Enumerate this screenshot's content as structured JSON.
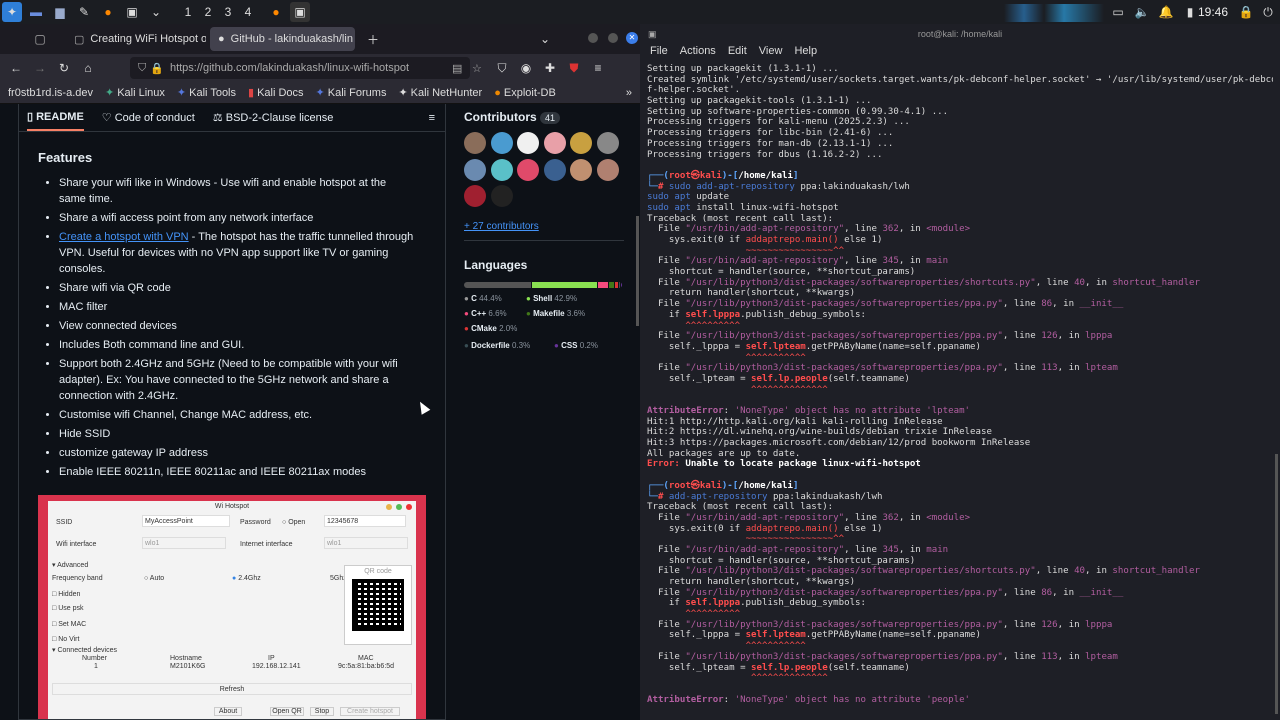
{
  "panel": {
    "workspaces": [
      "1",
      "2",
      "3",
      "4"
    ],
    "clock": "19:46"
  },
  "browser": {
    "tabs": [
      {
        "label": "Creating WiFi Hotspot on"
      },
      {
        "label": "GitHub - lakinduakash/lin"
      }
    ],
    "url": "https://github.com/lakinduakash/linux-wifi-hotspot",
    "bookmarks": [
      "fr0stb1rd.is-a.dev",
      "Kali Linux",
      "Kali Tools",
      "Kali Docs",
      "Kali Forums",
      "Kali NetHunter",
      "Exploit-DB"
    ],
    "readme_tabs": [
      "README",
      "Code of conduct",
      "BSD-2-Clause license"
    ],
    "features_title": "Features",
    "features": [
      "Share your wifi like in Windows - Use wifi and enable hotspot at the same time.",
      "Share a wifi access point from any network interface",
      {
        "link": "Create a hotspot with VPN",
        "rest": " - The hotspot has the traffic tunnelled through VPN. Useful for devices with no VPN app support like TV or gaming consoles."
      },
      "Share wifi via QR code",
      "MAC filter",
      "View connected devices",
      "Includes Both command line and GUI.",
      "Support both 2.4GHz and 5GHz (Need to be compatible with your wifi adapter). Ex: You have connected to the 5GHz network and share a connection with 2.4GHz.",
      "Customise wifi Channel, Change MAC address, etc.",
      "Hide SSID",
      "customize gateway IP address",
      "Enable IEEE 80211n, IEEE 80211ac and IEEE 80211ax modes"
    ],
    "hotspot_app": {
      "title": "Wi Hotspot",
      "ssid_label": "SSID",
      "ssid": "MyAccessPoint",
      "password_label": "Password",
      "open_label": "Open",
      "password": "12345678",
      "wifi_iface_label": "Wifi interface",
      "wifi_iface": "wlo1",
      "inet_iface_label": "Internet interface",
      "inet_iface": "wlo1",
      "advanced": "Advanced",
      "freq_label": "Frequency band",
      "auto": "Auto",
      "ghz24": "2.4Ghz",
      "ghz5": "5Ghz",
      "hidden": "Hidden",
      "use_psk": "Use psk",
      "set_mac": "Set MAC",
      "no_virt": "No Virt",
      "qr_label": "QR code",
      "connected": "Connected devices",
      "cols": [
        "Number",
        "Hostname",
        "IP",
        "MAC"
      ],
      "row": [
        "1",
        "M2101K6G",
        "192.168.12.141",
        "9c:5a:81:ba:b6:5d"
      ],
      "refresh": "Refresh",
      "buttons": [
        "About",
        "Open QR",
        "Stop",
        "Create hotspot"
      ]
    },
    "contributors": {
      "title": "Contributors",
      "count": "41",
      "more": "+ 27 contributors"
    },
    "languages": {
      "title": "Languages",
      "items": [
        {
          "name": "C",
          "pct": "44.4%",
          "color": "#555555"
        },
        {
          "name": "Shell",
          "pct": "42.9%",
          "color": "#89e051"
        },
        {
          "name": "C++",
          "pct": "6.6%",
          "color": "#f34b7d"
        },
        {
          "name": "Makefile",
          "pct": "3.6%",
          "color": "#427819"
        },
        {
          "name": "CMake",
          "pct": "2.0%",
          "color": "#da3434"
        },
        {
          "name": "Dockerfile",
          "pct": "0.3%",
          "color": "#384d54"
        },
        {
          "name": "CSS",
          "pct": "0.2%",
          "color": "#663399"
        }
      ]
    }
  },
  "terminal": {
    "title": "root@kali: /home/kali",
    "menu": [
      "File",
      "Actions",
      "Edit",
      "View",
      "Help"
    ],
    "lines": [
      "Setting up packagekit (1.3.1-1) ...",
      "Created symlink '/etc/systemd/user/sockets.target.wants/pk-debconf-helper.socket' → '/usr/lib/systemd/user/pk-debcon",
      "f-helper.socket'.",
      "Setting up packagekit-tools (1.3.1-1) ...",
      "Setting up software-properties-common (0.99.30-4.1) ...",
      "Processing triggers for kali-menu (2025.2.3) ...",
      "Processing triggers for libc-bin (2.41-6) ...",
      "Processing triggers for man-db (2.13.1-1) ...",
      "Processing triggers for dbus (1.16.2-2) ..."
    ],
    "prompt_user": "root㉿kali",
    "prompt_dir": "/home/kali",
    "cmd1": "sudo add-apt-repository ppa:lakinduakash/lwh",
    "cmd1b": "sudo apt update",
    "cmd1c": "sudo apt install linux-wifi-hotspot",
    "traceback": "Traceback (most recent call last):",
    "err_attr": "AttributeError: 'NoneType' object has no attribute 'lpteam'",
    "hits": [
      "Hit:1 http://http.kali.org/kali kali-rolling InRelease",
      "Hit:2 https://dl.winehq.org/wine-builds/debian trixie InRelease",
      "Hit:3 https://packages.microsoft.com/debian/12/prod bookworm InRelease",
      "All packages are up to date."
    ],
    "error_line": "Error: Unable to locate package linux-wifi-hotspot",
    "cmd2": "add-apt-repository ppa:lakinduakash/lwh",
    "err_attr2": "AttributeError: 'NoneType' object has no attribute 'people'"
  }
}
